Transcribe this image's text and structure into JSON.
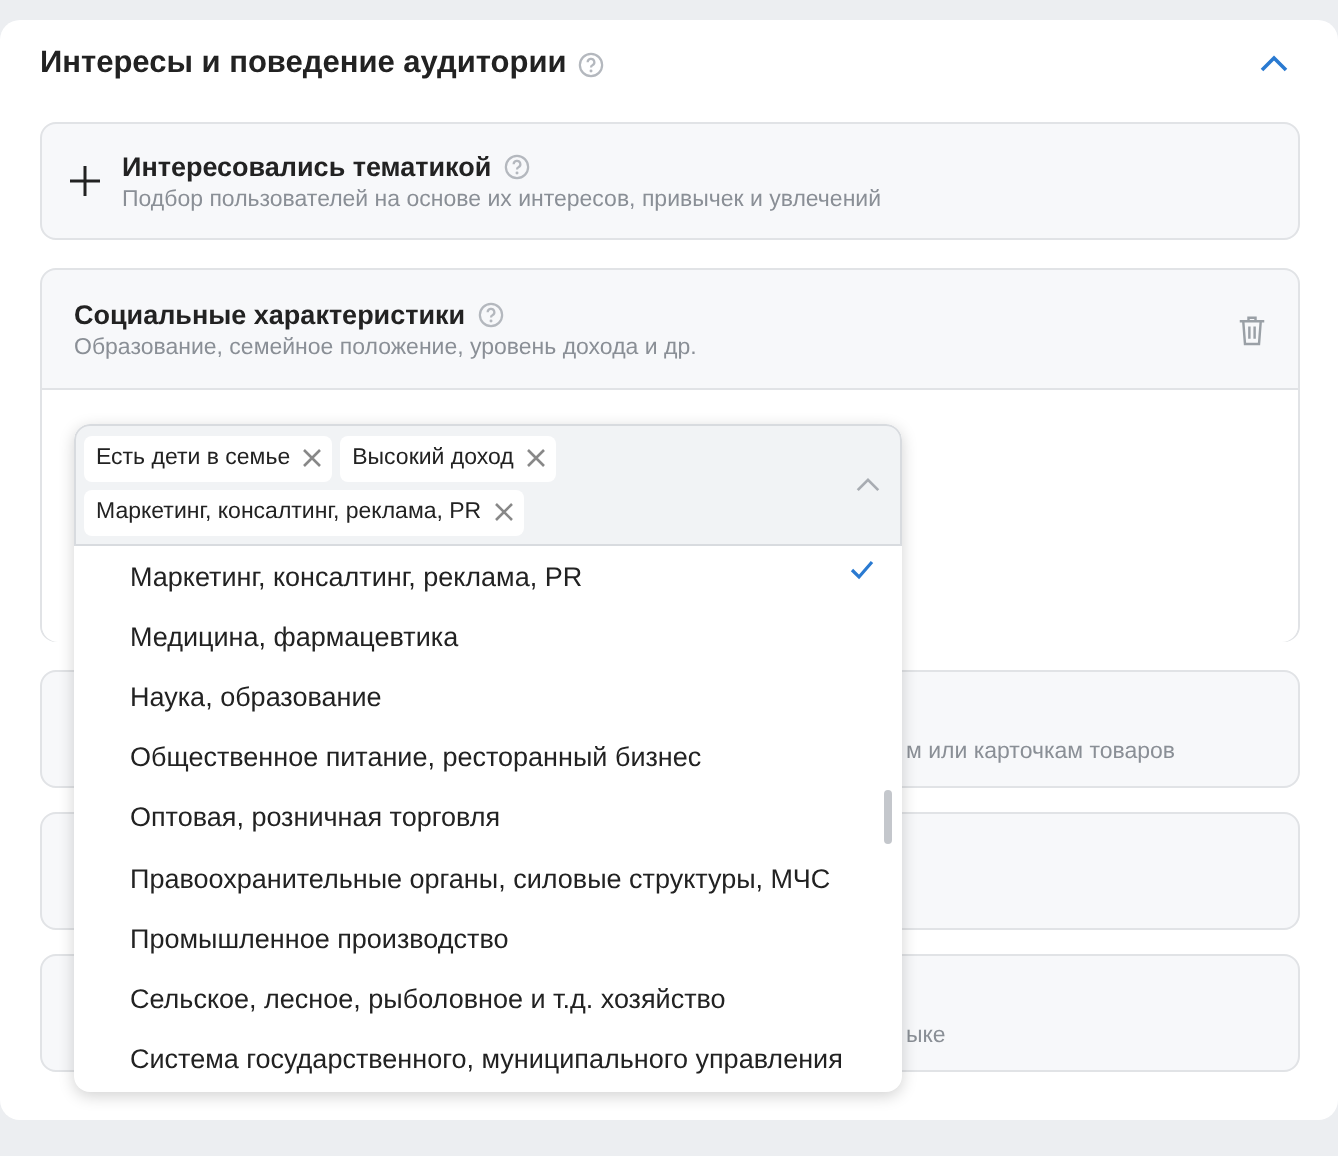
{
  "section": {
    "title": "Интересы и поведение аудитории",
    "expanded": true
  },
  "interest_card": {
    "title": "Интересовались тематикой",
    "description": "Подбор пользователей на основе их интересов, привычек и увлечений"
  },
  "social_card": {
    "title": "Социальные характеристики",
    "description": "Образование, семейное положение, уровень дохода и др.",
    "dropdown": {
      "chips": [
        "Есть дети в семье",
        "Высокий доход",
        "Маркетинг, консалтинг, реклама, PR"
      ],
      "options": [
        {
          "label": "Маркетинг, консалтинг, реклама, PR",
          "selected": true
        },
        {
          "label": "Медицина, фармацевтика",
          "selected": false
        },
        {
          "label": "Наука, образование",
          "selected": false
        },
        {
          "label": "Общественное питание, ресторанный бизнес",
          "selected": false
        },
        {
          "label": "Оптовая, розничная торговля",
          "selected": false
        },
        {
          "label": "Правоохранительные органы, силовые структуры, МЧС",
          "selected": false
        },
        {
          "label": "Промышленное производство",
          "selected": false
        },
        {
          "label": "Сельское, лесное, рыболовное и т.д. хозяйство",
          "selected": false
        },
        {
          "label": "Система государственного, муниципального управления",
          "selected": false
        }
      ]
    }
  },
  "hidden_cards": [
    {
      "kind": "with_text",
      "description": "м или карточкам товаров"
    },
    {
      "kind": "blank"
    },
    {
      "kind": "with_text",
      "description": "ыке"
    }
  ]
}
